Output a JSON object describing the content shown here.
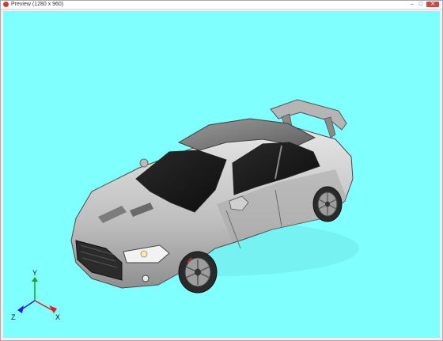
{
  "window": {
    "title": "Preview (1280 x 960)",
    "buttons": {
      "minimize": "–",
      "maximize": "□",
      "close": "✕"
    }
  },
  "viewport": {
    "background": "#80ffff",
    "object_icon": "car-3d-model-icon"
  },
  "axes": {
    "x_label": "X",
    "y_label": "Y",
    "z_label": "Z",
    "x_color": "#e02020",
    "y_color": "#20a020",
    "z_color": "#2020e0"
  }
}
